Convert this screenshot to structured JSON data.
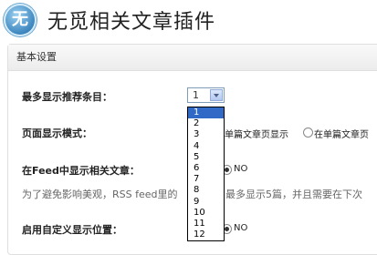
{
  "header": {
    "logo_char": "无",
    "title": "无觅相关文章插件"
  },
  "panel": {
    "section_title": "基本设置",
    "max_items": {
      "label": "最多显示推荐条目：",
      "selected": "1",
      "options": [
        "1",
        "2",
        "3",
        "4",
        "5",
        "6",
        "7",
        "8",
        "9",
        "10",
        "11",
        "12"
      ]
    },
    "display_mode": {
      "label": "页面显示模式：",
      "option1": "单篇文章页显示",
      "option2": "在单篇文章页"
    },
    "feed": {
      "label": "在Feed中显示相关文章：",
      "no": "NO",
      "desc": "为了避免影响美观，RSS feed里的",
      "desc_tail": "最多显示5篇，并且需要在下次"
    },
    "custom_position": {
      "label": "启用自定义显示位置：",
      "no": "NO"
    }
  }
}
